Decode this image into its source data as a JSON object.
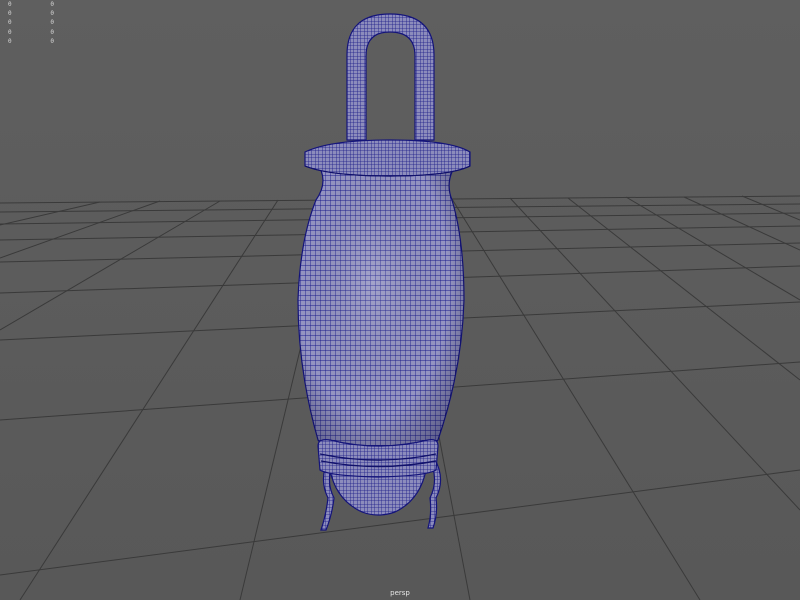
{
  "viewport": {
    "camera_label": "persp",
    "background_color": "#5e5e5e",
    "grid_color": "#3a3a3a",
    "wireframe_color": "#1a1a8a",
    "mesh_fill_color": "#8a8ab8"
  },
  "hud_stats": [
    {
      "left": "0",
      "right": "0"
    },
    {
      "left": "0",
      "right": "0"
    },
    {
      "left": "0",
      "right": "0"
    },
    {
      "left": "0",
      "right": "0"
    },
    {
      "left": "0",
      "right": "0"
    }
  ],
  "scene": {
    "object_icon": "wireframe-vase-icon"
  }
}
